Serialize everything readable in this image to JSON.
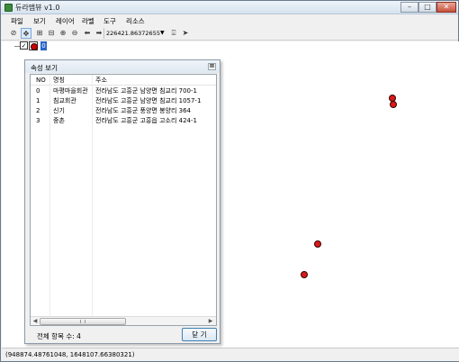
{
  "window": {
    "title": "듀라맵뷰 v1.0",
    "controls": {
      "minimize": "–",
      "maximize": "□",
      "close": "✕"
    }
  },
  "menu": [
    "파일",
    "보기",
    "레이어",
    "라벨",
    "도구",
    "리소스"
  ],
  "toolbar": {
    "scale_value": "226421.86372655",
    "icons": [
      "link-icon",
      "pan-icon",
      "zoom-extent-icon",
      "zoom-box-icon",
      "zoom-in-icon",
      "zoom-out-icon",
      "back-arrow-icon",
      "forward-arrow-icon",
      "measure-icon",
      "pointer-icon"
    ]
  },
  "layer": {
    "checked": "✓",
    "index": "0"
  },
  "attribute_dialog": {
    "title": "속성 보기",
    "close_label": "⊠",
    "columns": [
      "NO",
      "명칭",
      "주소"
    ],
    "rows": [
      [
        "0",
        "마평마을회관",
        "전라남도 고흥군 남양면 침교리 700-1"
      ],
      [
        "1",
        "침교회관",
        "전라남도 고흥군 남양면 침교리 1057-1"
      ],
      [
        "2",
        "신기",
        "전라남도 고흥군 풍양면 봉양리 364"
      ],
      [
        "3",
        "중촌",
        "전라남도 고흥군 고흥읍 고소리 424-1"
      ]
    ],
    "count_label": "전체 항목 수: 4",
    "close_button": "닫 기"
  },
  "status": {
    "coordinates": "(948874.48761048, 1648107.66380321)"
  },
  "colors": {
    "point_fill": "#d81a1a",
    "title_gradient": "#d6e2ee"
  }
}
